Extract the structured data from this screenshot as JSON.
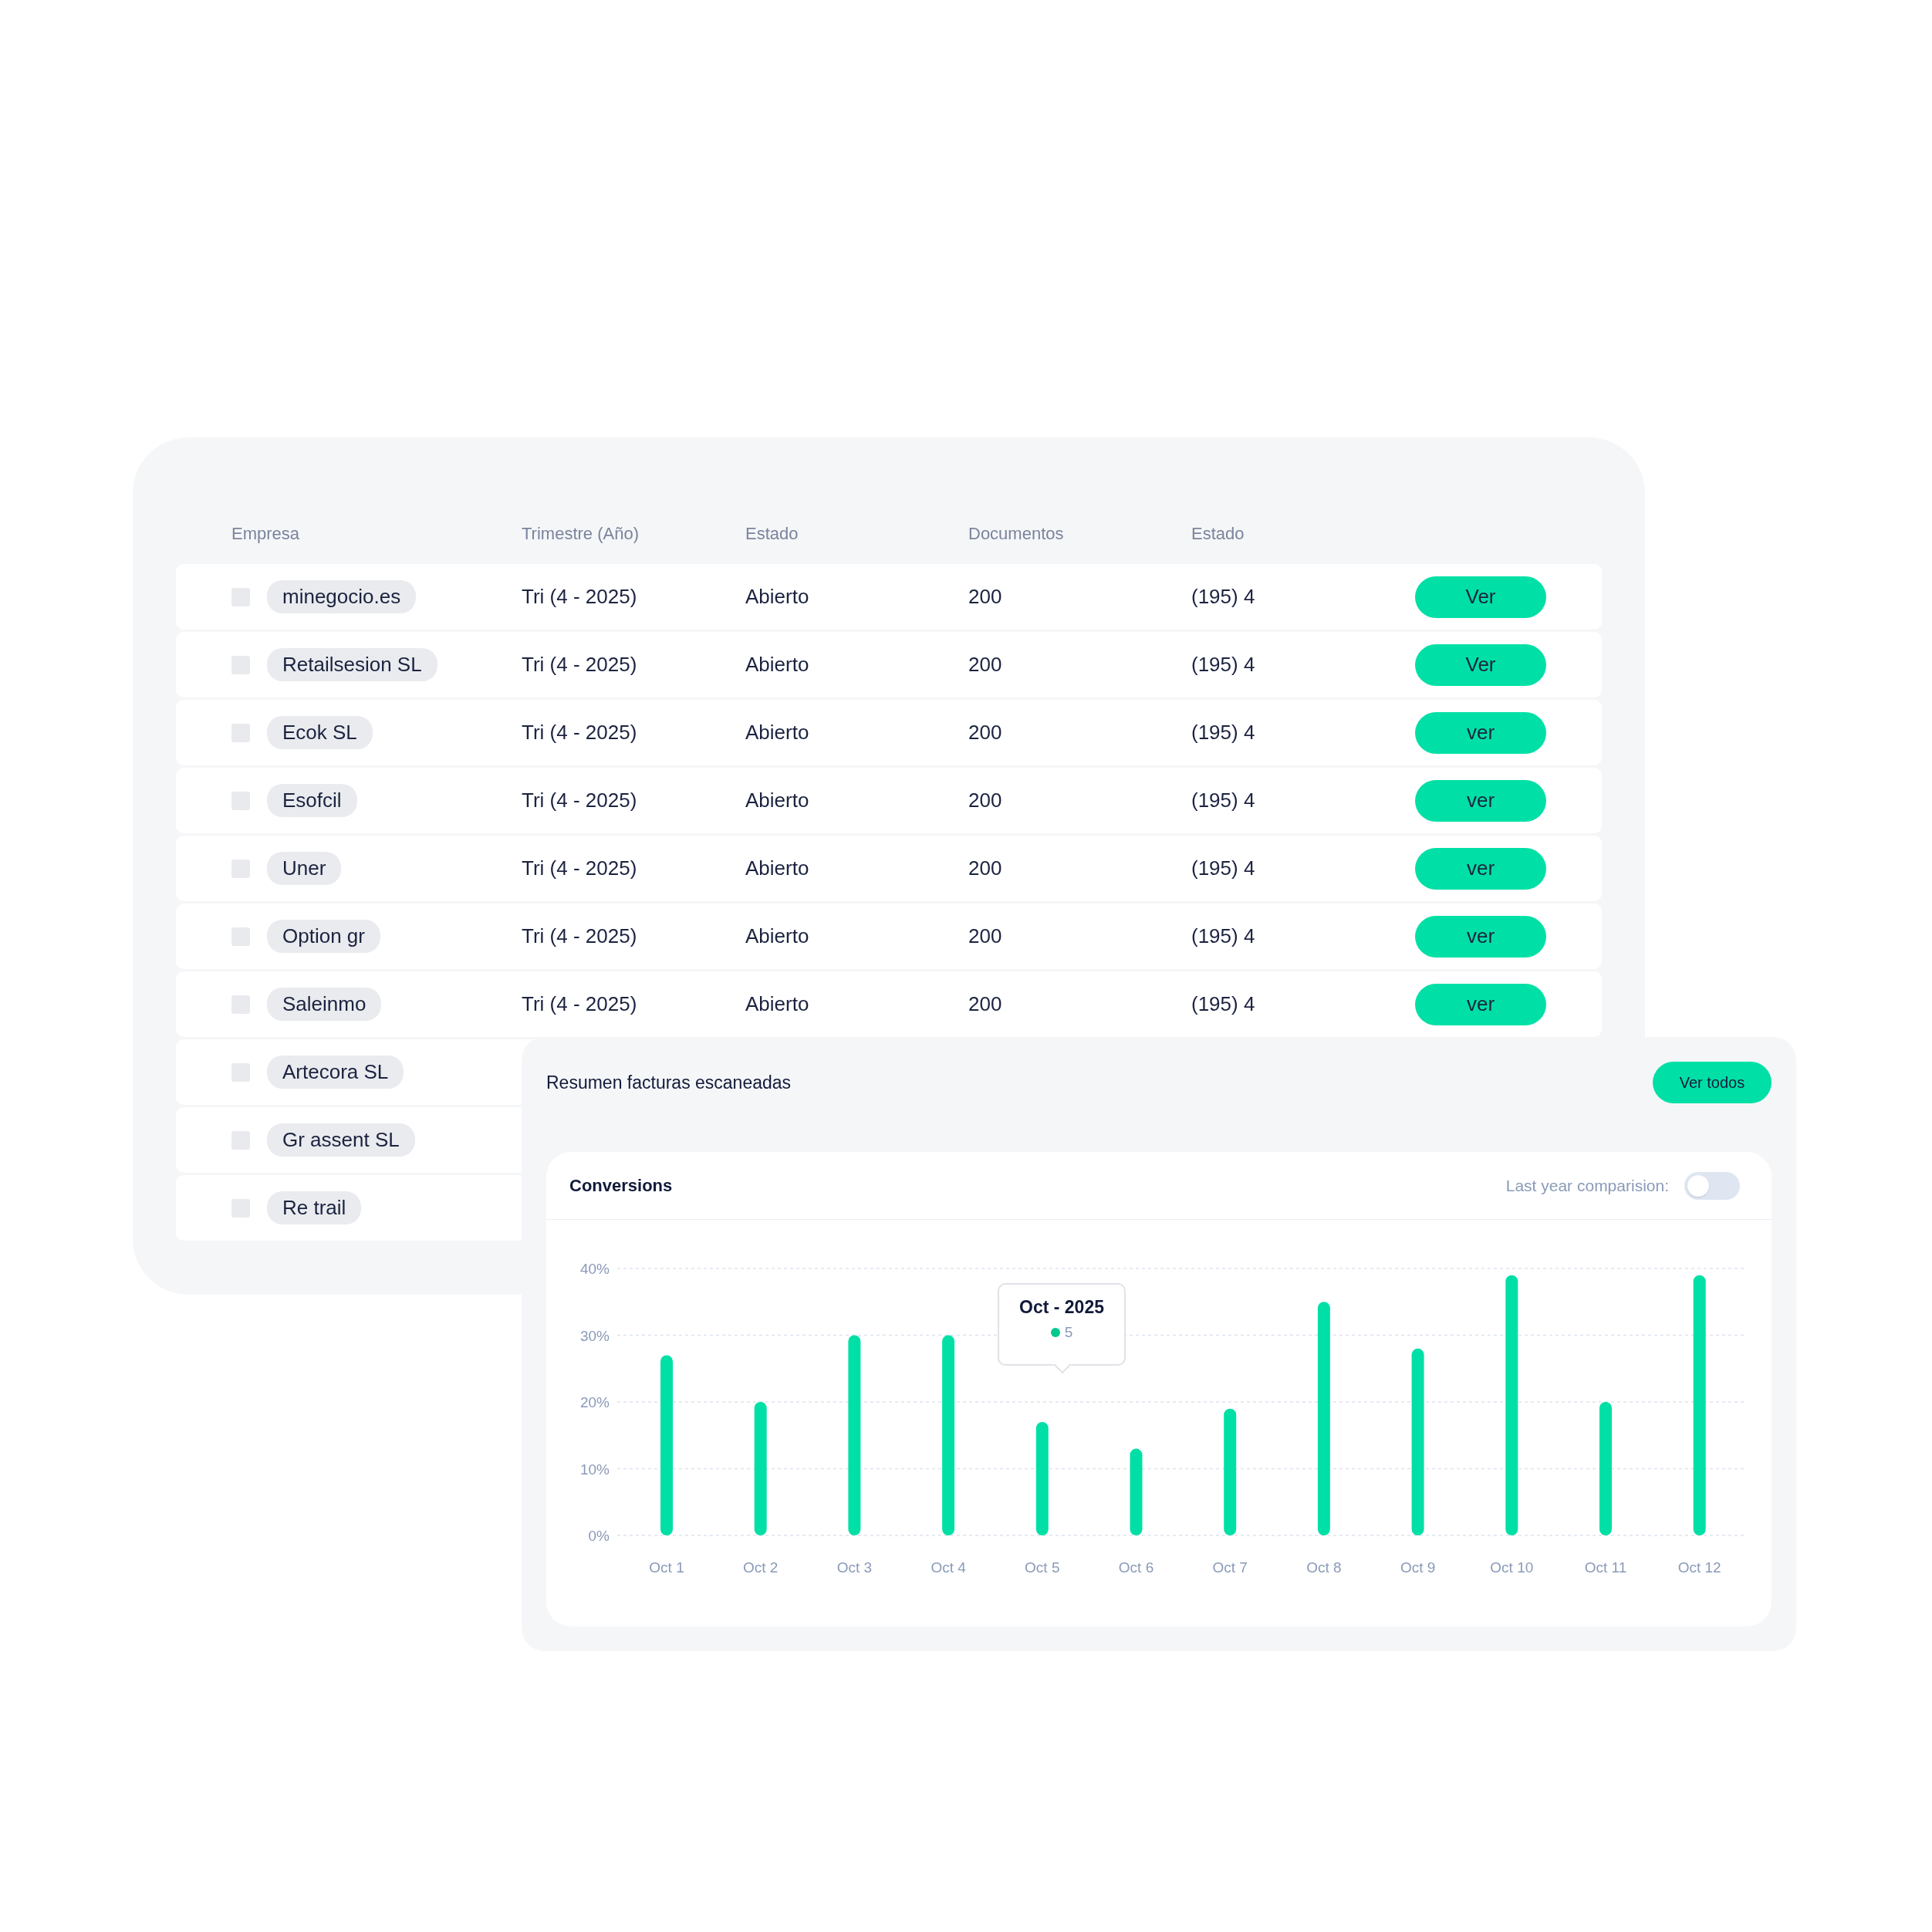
{
  "table": {
    "columns": [
      "Empresa",
      "Trimestre (Año)",
      "Estado",
      "Documentos",
      "Estado"
    ],
    "rows": [
      {
        "checked": false,
        "company": "minegocio.es",
        "quarter": "Tri (4 - 2025)",
        "status": "Abierto",
        "documents": "200",
        "state": "(195) 4",
        "action": "Ver"
      },
      {
        "checked": false,
        "company": "Retailsesion SL",
        "quarter": "Tri (4 - 2025)",
        "status": "Abierto",
        "documents": "200",
        "state": "(195) 4",
        "action": "Ver"
      },
      {
        "checked": false,
        "company": "Ecok SL",
        "quarter": "Tri (4 - 2025)",
        "status": "Abierto",
        "documents": "200",
        "state": "(195) 4",
        "action": "ver"
      },
      {
        "checked": false,
        "company": "Esofcil",
        "quarter": "Tri (4 - 2025)",
        "status": "Abierto",
        "documents": "200",
        "state": "(195) 4",
        "action": "ver"
      },
      {
        "checked": false,
        "company": "Uner",
        "quarter": "Tri (4 - 2025)",
        "status": "Abierto",
        "documents": "200",
        "state": "(195) 4",
        "action": "ver"
      },
      {
        "checked": false,
        "company": "Option gr",
        "quarter": "Tri (4 - 2025)",
        "status": "Abierto",
        "documents": "200",
        "state": "(195) 4",
        "action": "ver"
      },
      {
        "checked": false,
        "company": "Saleinmo",
        "quarter": "Tri (4 - 2025)",
        "status": "Abierto",
        "documents": "200",
        "state": "(195) 4",
        "action": "ver"
      },
      {
        "checked": false,
        "company": "Artecora SL"
      },
      {
        "checked": false,
        "company": "Gr assent SL"
      },
      {
        "checked": false,
        "company": "Re trail"
      }
    ]
  },
  "summary": {
    "title": "Resumen facturas escaneadas",
    "button": "Ver todos",
    "chart_card": {
      "title": "Conversions",
      "toggle": {
        "label": "Last year comparision:",
        "on": false
      },
      "chart_data": {
        "type": "bar",
        "categories": [
          "Oct 1",
          "Oct 2",
          "Oct 3",
          "Oct 4",
          "Oct 5",
          "Oct 6",
          "Oct 7",
          "Oct 8",
          "Oct 9",
          "Oct 10",
          "Oct 11",
          "Oct 12"
        ],
        "grid": true,
        "series": [
          {
            "color": "#00e0a6",
            "values": [
              27,
              20,
              30,
              30,
              17,
              13,
              19,
              35,
              28,
              39,
              20,
              39
            ]
          }
        ],
        "ylim": [
          0,
          40
        ],
        "yticks": [
          {
            "value": 0,
            "label": "0%"
          },
          {
            "value": 10,
            "label": "10%"
          },
          {
            "value": 20,
            "label": "20%"
          },
          {
            "value": 30,
            "label": "30%"
          },
          {
            "value": 40,
            "label": "40%"
          }
        ]
      },
      "tooltip": {
        "title": "Oct - 2025",
        "value": "5",
        "color": "#00c98f"
      }
    }
  }
}
